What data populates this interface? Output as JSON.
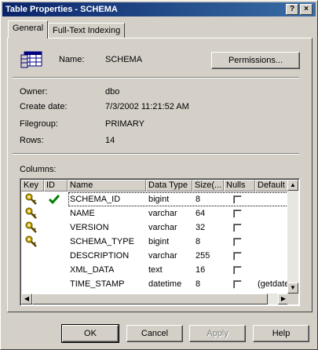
{
  "window": {
    "title": "Table Properties - SCHEMA",
    "help_label": "?",
    "close_label": "×"
  },
  "tabs": [
    {
      "label": "General"
    },
    {
      "label": "Full-Text Indexing"
    }
  ],
  "general": {
    "name_label": "Name:",
    "name_value": "SCHEMA",
    "permissions_button": "Permissions...",
    "owner_label": "Owner:",
    "owner_value": "dbo",
    "create_date_label": "Create date:",
    "create_date_value": "7/3/2002 11:21:52 AM",
    "filegroup_label": "Filegroup:",
    "filegroup_value": "PRIMARY",
    "rows_label": "Rows:",
    "rows_value": "14",
    "columns_label": "Columns:"
  },
  "grid": {
    "headers": [
      "Key",
      "ID",
      "Name",
      "Data Type",
      "Size(...",
      "Nulls",
      "Default"
    ],
    "rows": [
      {
        "key": true,
        "id": true,
        "name": "SCHEMA_ID",
        "type": "bigint",
        "size": "8",
        "nulls": false,
        "default": ""
      },
      {
        "key": true,
        "id": false,
        "name": "NAME",
        "type": "varchar",
        "size": "64",
        "nulls": false,
        "default": ""
      },
      {
        "key": true,
        "id": false,
        "name": "VERSION",
        "type": "varchar",
        "size": "32",
        "nulls": false,
        "default": ""
      },
      {
        "key": true,
        "id": false,
        "name": "SCHEMA_TYPE",
        "type": "bigint",
        "size": "8",
        "nulls": false,
        "default": ""
      },
      {
        "key": false,
        "id": false,
        "name": "DESCRIPTION",
        "type": "varchar",
        "size": "255",
        "nulls": false,
        "default": ""
      },
      {
        "key": false,
        "id": false,
        "name": "XML_DATA",
        "type": "text",
        "size": "16",
        "nulls": false,
        "default": ""
      },
      {
        "key": false,
        "id": false,
        "name": "TIME_STAMP",
        "type": "datetime",
        "size": "8",
        "nulls": false,
        "default": "(getdate"
      }
    ],
    "key_icon": "key-icon",
    "identity_icon": "green-checkmark-icon"
  },
  "buttons": {
    "ok": "OK",
    "cancel": "Cancel",
    "apply": "Apply",
    "help": "Help"
  },
  "colors": {
    "titlebar_start": "#0a246a",
    "titlebar_end": "#3a6ea5",
    "key_gold": "#c8a800",
    "check_green": "#008000"
  }
}
